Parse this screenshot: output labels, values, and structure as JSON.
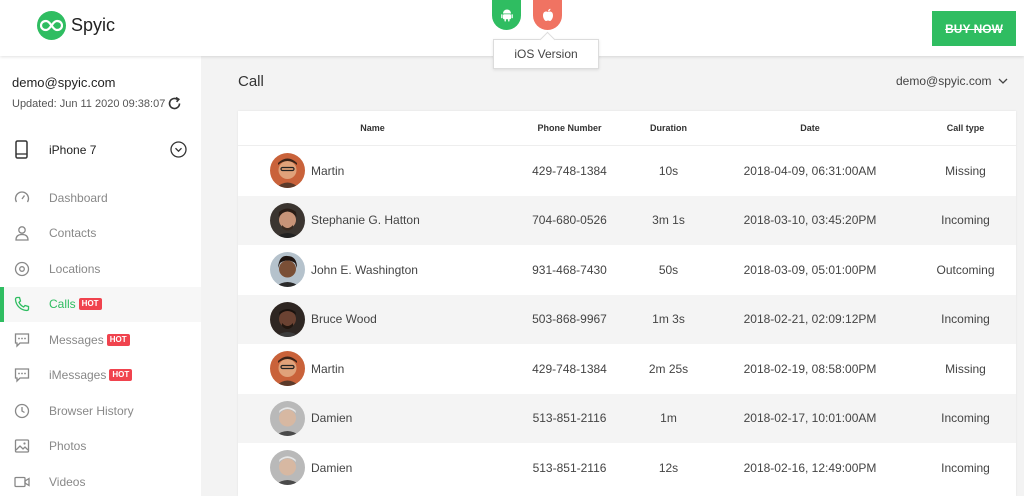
{
  "app": {
    "name": "Spyic"
  },
  "os_switch": {
    "android_icon": "android-icon",
    "ios_icon": "apple-icon",
    "tooltip": "iOS Version"
  },
  "header": {
    "buy_now": "BUY NOW"
  },
  "account": {
    "email": "demo@spyic.com",
    "updated": "Updated: Jun 11 2020 09:38:07"
  },
  "device": {
    "name": "iPhone 7"
  },
  "sidebar": {
    "items": [
      {
        "label": "Dashboard",
        "icon": "dashboard-icon",
        "hot": ""
      },
      {
        "label": "Contacts",
        "icon": "contacts-icon",
        "hot": ""
      },
      {
        "label": "Locations",
        "icon": "location-icon",
        "hot": ""
      },
      {
        "label": "Calls",
        "icon": "phone-icon",
        "hot": "HOT"
      },
      {
        "label": "Messages",
        "icon": "message-icon",
        "hot": "HOT"
      },
      {
        "label": "iMessages",
        "icon": "imessage-icon",
        "hot": "HOT"
      },
      {
        "label": "Browser History",
        "icon": "clock-icon",
        "hot": ""
      },
      {
        "label": "Photos",
        "icon": "photo-icon",
        "hot": ""
      },
      {
        "label": "Videos",
        "icon": "video-icon",
        "hot": ""
      }
    ]
  },
  "main": {
    "title": "Call",
    "email": "demo@spyic.com"
  },
  "table": {
    "headers": {
      "name": "Name",
      "phone": "Phone Number",
      "duration": "Duration",
      "date": "Date",
      "type": "Call type"
    },
    "rows": [
      {
        "name": "Martin",
        "phone": "429-748-1384",
        "duration": "10s",
        "date": "2018-04-09, 06:31:00AM",
        "type": "Missing"
      },
      {
        "name": "Stephanie G. Hatton",
        "phone": "704-680-0526",
        "duration": "3m 1s",
        "date": "2018-03-10, 03:45:20PM",
        "type": "Incoming"
      },
      {
        "name": "John E. Washington",
        "phone": "931-468-7430",
        "duration": "50s",
        "date": "2018-03-09, 05:01:00PM",
        "type": "Outcoming"
      },
      {
        "name": "Bruce Wood",
        "phone": "503-868-9967",
        "duration": "1m 3s",
        "date": "2018-02-21, 02:09:12PM",
        "type": "Incoming"
      },
      {
        "name": "Martin",
        "phone": "429-748-1384",
        "duration": "2m 25s",
        "date": "2018-02-19, 08:58:00PM",
        "type": "Missing"
      },
      {
        "name": "Damien",
        "phone": "513-851-2116",
        "duration": "1m",
        "date": "2018-02-17, 10:01:00AM",
        "type": "Incoming"
      },
      {
        "name": "Damien",
        "phone": "513-851-2116",
        "duration": "12s",
        "date": "2018-02-16, 12:49:00PM",
        "type": "Incoming"
      }
    ]
  },
  "colors": {
    "brand": "#2fbd61",
    "ios": "#f07362",
    "hot": "#f0434e"
  }
}
